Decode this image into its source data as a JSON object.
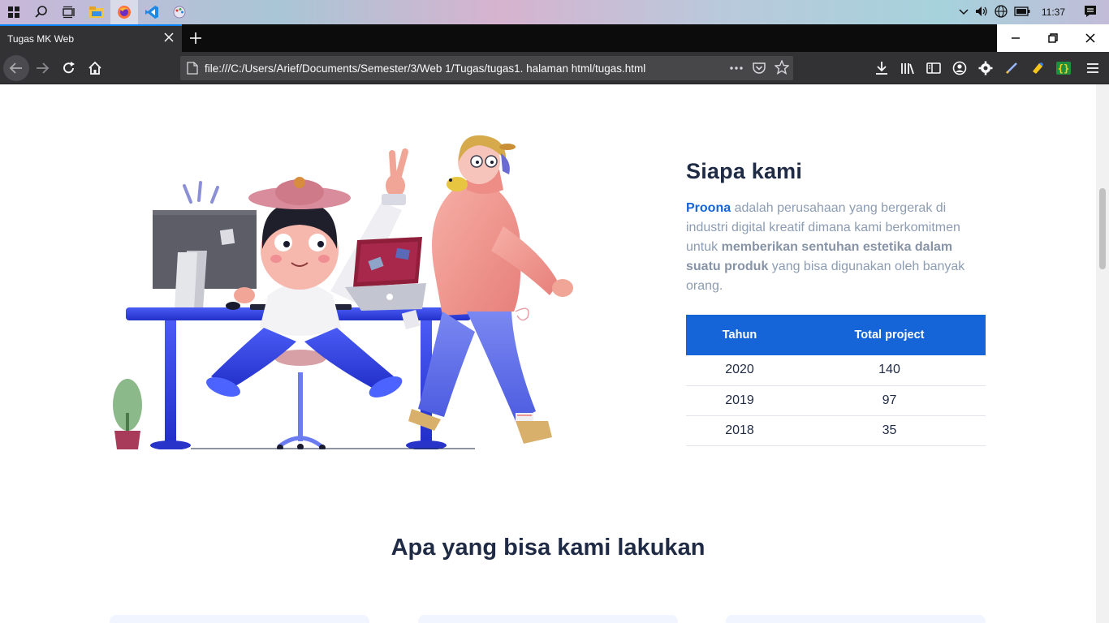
{
  "taskbar": {
    "clock": "11:37"
  },
  "browser": {
    "tab_title": "Tugas MK Web",
    "url": "file:///C:/Users/Arief/Documents/Semester/3/Web 1/Tugas/tugas1. halaman html/tugas.html"
  },
  "about": {
    "title": "Siapa kami",
    "brand": "Proona",
    "text_1": " adalah perusahaan yang bergerak di industri digital kreatif dimana kami berkomitmen untuk ",
    "emphasis": "memberikan sentuhan estetika dalam suatu produk",
    "text_2": " yang bisa digunakan oleh banyak orang."
  },
  "stats_table": {
    "headers": [
      "Tahun",
      "Total project"
    ],
    "rows": [
      [
        "2020",
        "140"
      ],
      [
        "2019",
        "97"
      ],
      [
        "2018",
        "35"
      ]
    ]
  },
  "services": {
    "title": "Apa yang bisa kami lakukan"
  },
  "colors": {
    "accent": "#1565d8",
    "heading": "#1f2a44",
    "body_text": "#8c9cb2"
  }
}
